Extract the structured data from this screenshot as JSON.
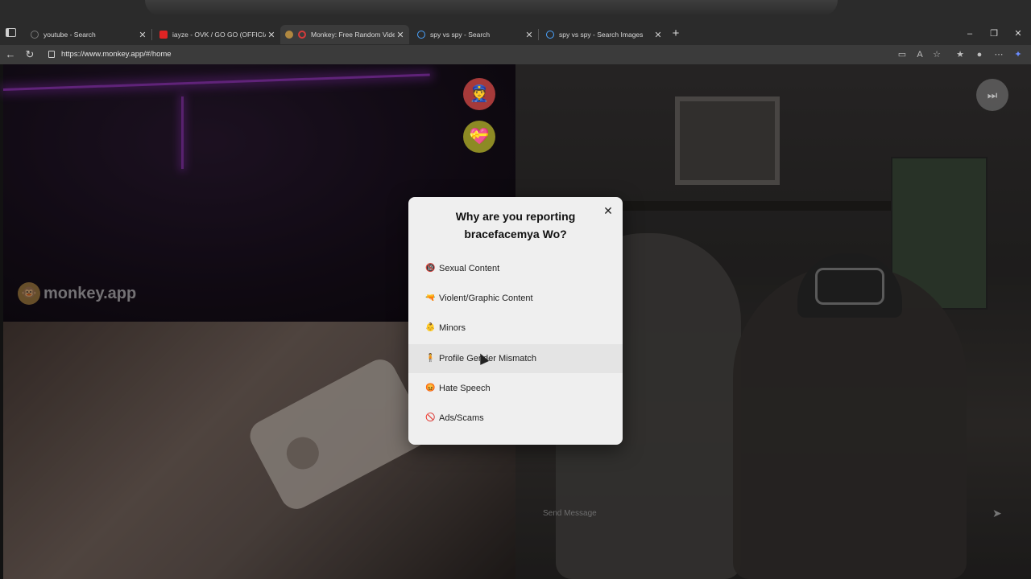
{
  "browser": {
    "tabs": [
      {
        "title": "youtube - Search",
        "favicon": "search-icon",
        "active": false
      },
      {
        "title": "iayze - OVK / GO GO (OFFICIAL M",
        "favicon": "youtube-icon",
        "active": false
      },
      {
        "title": "Monkey: Free Random Video",
        "favicon": "monkey-icon",
        "active": true
      },
      {
        "title": "spy vs spy - Search",
        "favicon": "search-icon",
        "active": false
      },
      {
        "title": "spy vs spy - Search Images",
        "favicon": "search-icon",
        "active": false
      }
    ],
    "url": "https://www.monkey.app/#/home",
    "colors": {
      "tabbar": "#2b2b2b",
      "toolbar": "#3b3b3b",
      "accent": "#d63b3b"
    }
  },
  "page": {
    "brand_name": "monkey.app",
    "message_placeholder": "Send Message",
    "side_buttons": [
      {
        "name": "report",
        "icon": "police-officer-icon"
      },
      {
        "name": "add-friend",
        "icon": "heart-icon"
      }
    ],
    "skip_icon": "skip-forward-icon"
  },
  "report_modal": {
    "heading": "Why are you reporting bracefacemya Wo?",
    "close_icon": "close-icon",
    "options": [
      {
        "label": "Sexual Content",
        "icon": "no-adults-icon",
        "emoji": "🔞"
      },
      {
        "label": "Violent/Graphic Content",
        "icon": "water-pistol-icon",
        "emoji": "🔫"
      },
      {
        "label": "Minors",
        "icon": "child-icon",
        "emoji": "👶"
      },
      {
        "label": "Profile Gender Mismatch",
        "icon": "person-icon",
        "emoji": "🧍"
      },
      {
        "label": "Hate Speech",
        "icon": "angry-face-icon",
        "emoji": "😡"
      },
      {
        "label": "Ads/Scams",
        "icon": "prohibited-icon",
        "emoji": "🚫"
      }
    ],
    "hovered_option": "Profile Gender Mismatch"
  }
}
